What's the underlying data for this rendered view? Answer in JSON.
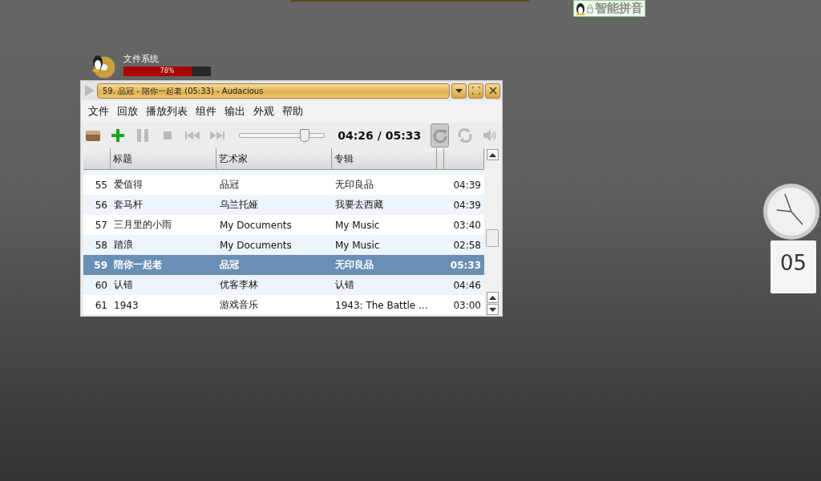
{
  "input_method": {
    "label": "智能拼音"
  },
  "disk": {
    "label": "文件系统",
    "level": 0.78,
    "reading": "78%"
  },
  "player": {
    "title": "59. 品冠 - 陪你一起老 (05:33) - Audacious",
    "menu": [
      "文件",
      "回放",
      "播放列表",
      "组件",
      "输出",
      "外观",
      "帮助"
    ],
    "seek": {
      "level": 0.76
    },
    "time": "04:26 / 05:33",
    "toggles": [
      {
        "kind": "repeat",
        "on": true
      },
      {
        "kind": "shuffle",
        "on": false
      }
    ],
    "columns": [
      "标题",
      "艺术家",
      "专辑"
    ],
    "rows": [
      {
        "number": "55",
        "title": "爱值得",
        "artist": "品冠",
        "album": "无印良品",
        "length": "04:39",
        "selected": false
      },
      {
        "number": "56",
        "title": "套马杆",
        "artist": "乌兰托娅",
        "album": "我要去西藏",
        "length": "04:39",
        "selected": false
      },
      {
        "number": "57",
        "title": "三月里的小雨",
        "artist": "My Documents",
        "album": "My Music",
        "length": "03:40",
        "selected": false
      },
      {
        "number": "58",
        "title": "踏浪",
        "artist": "My Documents",
        "album": "My Music",
        "length": "02:58",
        "selected": false
      },
      {
        "number": "59",
        "title": "陪你一起老",
        "artist": "品冠",
        "album": "无印良品",
        "length": "05:33",
        "selected": true
      },
      {
        "number": "60",
        "title": "认错",
        "artist": "优客李林",
        "album": "认错",
        "length": "04:46",
        "selected": false
      },
      {
        "number": "61",
        "title": "1943",
        "artist": "游戏音乐",
        "album": "1943: The Battle ...",
        "length": "03:00",
        "selected": false
      }
    ]
  },
  "calendar": {
    "day": "05"
  }
}
